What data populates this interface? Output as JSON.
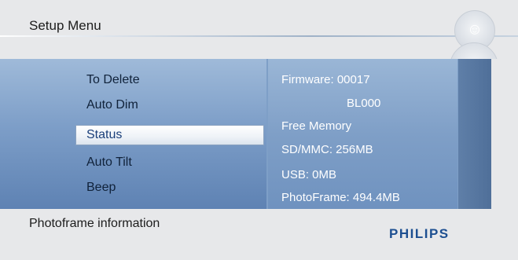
{
  "header": {
    "title": "Setup Menu"
  },
  "menu": {
    "items": [
      {
        "label": "To Delete"
      },
      {
        "label": "Auto Dim"
      },
      {
        "label": "Status",
        "selected": true
      },
      {
        "label": "Auto Tilt"
      },
      {
        "label": "Beep"
      }
    ]
  },
  "info": {
    "lines": [
      "Firmware: 00017",
      "BL000",
      "Free Memory",
      "SD/MMC: 256MB",
      "USB:  0MB",
      "PhotoFrame: 494.4MB"
    ]
  },
  "footer": {
    "description": "Photoframe information",
    "brand": "PHILIPS"
  },
  "icons": {
    "deco_top": "face-icon",
    "deco_mid": "navigation-icon",
    "deco_bottom": "menu-icon"
  },
  "colors": {
    "background": "#e7e8ea",
    "menu_panel": "#7d9ec8",
    "selection": "#ffffff",
    "selected_text": "#1a3f7a",
    "brand": "#1d4f91"
  }
}
